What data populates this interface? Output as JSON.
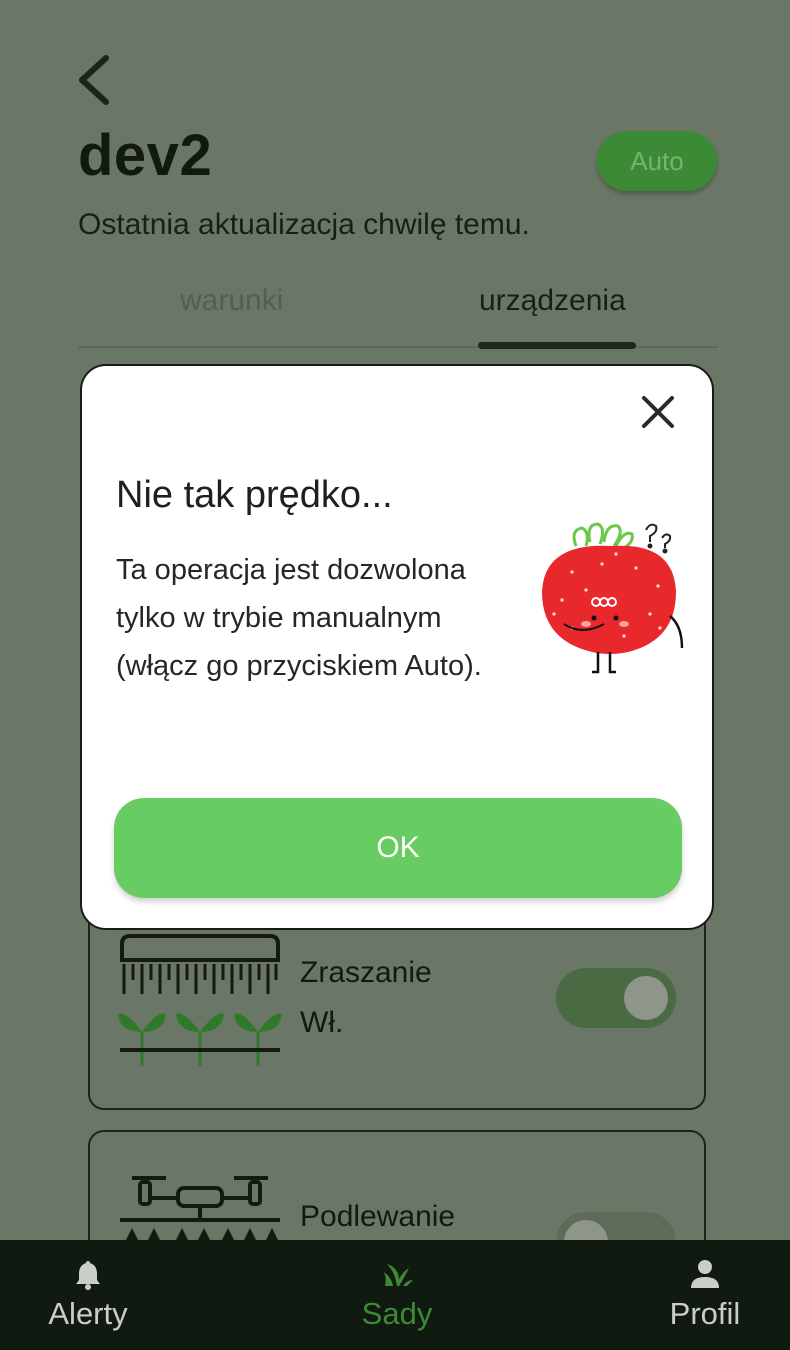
{
  "header": {
    "title": "dev2",
    "auto_button": "Auto",
    "subtitle": "Ostatnia aktualizacja chwilę temu.",
    "tabs": [
      {
        "label": "warunki",
        "active": false
      },
      {
        "label": "urządzenia",
        "active": true
      }
    ]
  },
  "devices": [
    {
      "name": "Zraszanie",
      "status": "Wł.",
      "icon": "sprinkler-plants-icon",
      "on": true
    },
    {
      "name": "Podlewanie",
      "icon": "irrigation-drone-icon",
      "on": false
    }
  ],
  "modal": {
    "title": "Nie tak prędko...",
    "body": "Ta operacja jest dozwolona tylko w trybie manualnym (włącz go przyciskiem Auto).",
    "ok_label": "OK",
    "illustration": "confused-strawberry"
  },
  "bottom_nav": {
    "items": [
      {
        "label": "Alerty",
        "icon": "bell-icon",
        "active": false
      },
      {
        "label": "Sady",
        "icon": "plant-icon",
        "active": true
      },
      {
        "label": "Profil",
        "icon": "person-icon",
        "active": false
      }
    ]
  },
  "colors": {
    "overlay_background": "#6b7766",
    "accent_green": "#67cd62",
    "auto_button": "#3d8a36",
    "nav_background": "#111a11",
    "nav_active": "#3d8a36",
    "nav_inactive": "#c9cec7"
  }
}
